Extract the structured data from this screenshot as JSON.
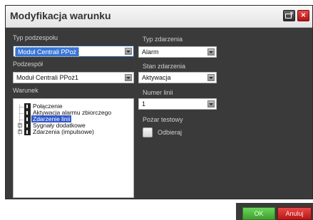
{
  "window": {
    "title": "Modyfikacja warunku",
    "help_label": "?",
    "close_label": "×"
  },
  "left": {
    "typ_podzespolu": {
      "label": "Typ podzespołu",
      "value": "Moduł Centrali PPoż"
    },
    "podzespol": {
      "label": "Podzespół",
      "value": "Moduł Centrali PPoż1"
    },
    "warunek": {
      "label": "Warunek",
      "tree": [
        {
          "label": "Połączenie",
          "expandable": false,
          "selected": false
        },
        {
          "label": "Aktywacja alarmu zbiorczego",
          "expandable": false,
          "selected": false
        },
        {
          "label": "Zdarzenie linii",
          "expandable": false,
          "selected": true
        },
        {
          "label": "Sygnały dodatkowe",
          "expandable": true,
          "selected": false
        },
        {
          "label": "Zdarzenia (impulsowe)",
          "expandable": true,
          "selected": false
        }
      ]
    }
  },
  "right": {
    "typ_zdarzenia": {
      "label": "Typ zdarzenia",
      "value": "Alarm"
    },
    "stan_zdarzenia": {
      "label": "Stan zdarzenia",
      "value": "Aktywacja"
    },
    "numer_linii": {
      "label": "Numer linii",
      "value": "1"
    },
    "pozar_testowy": {
      "label": "Pożar testowy",
      "checkbox_label": "Odbieraj",
      "checked": false
    }
  },
  "footer": {
    "ok_label": "OK",
    "cancel_label": "Anuluj"
  },
  "colors": {
    "panel_bg": "#3a3a3a",
    "ok_green": "#4caf3a",
    "cancel_red": "#d32f2f",
    "selection_blue": "#3158c9"
  }
}
